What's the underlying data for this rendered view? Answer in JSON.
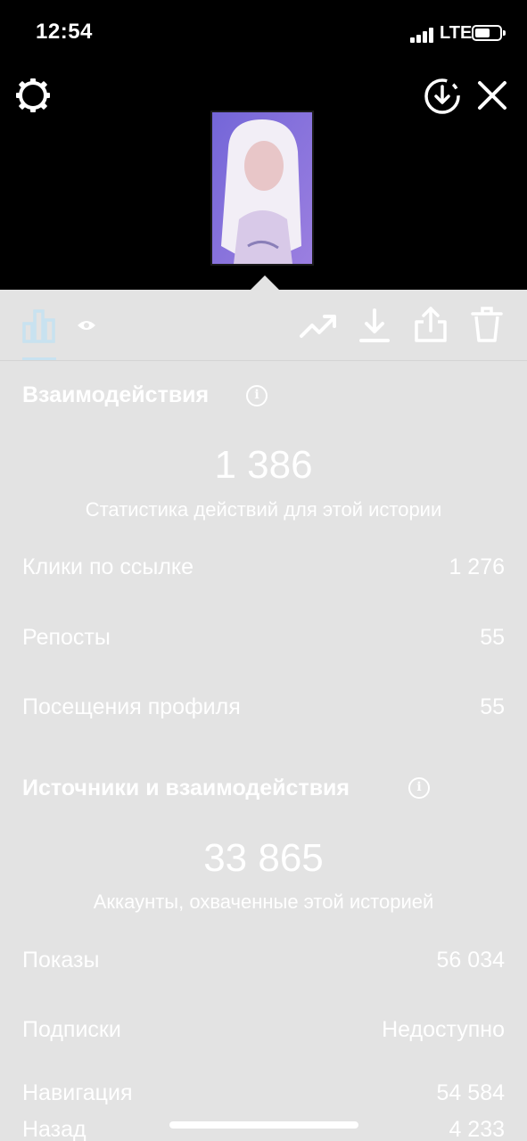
{
  "status_bar": {
    "time": "12:54",
    "network": "LTE"
  },
  "top_bar": {
    "icons": [
      "settings-gear-icon",
      "download-circle-icon",
      "close-icon"
    ]
  },
  "toolbar": {
    "tabs": [
      "insights-bar-chart-icon",
      "viewers-eye-icon"
    ],
    "actions": [
      "promote-trend-icon",
      "download-icon",
      "share-icon",
      "delete-trash-icon"
    ],
    "active_tab_color": "#c8e2f0"
  },
  "interactions": {
    "title": "Взаимодействия",
    "total": "1 386",
    "caption": "Статистика действий для этой истории",
    "rows": [
      {
        "label": "Клики по ссылке",
        "value": "1 276"
      },
      {
        "label": "Репосты",
        "value": "55"
      },
      {
        "label": "Посещения профиля",
        "value": "55"
      }
    ]
  },
  "discovery": {
    "title": "Источники и взаимодействия",
    "total": "33 865",
    "caption": "Аккаунты, охваченные этой историей",
    "rows": [
      {
        "label": "Показы",
        "value": "56 034"
      },
      {
        "label": "Подписки",
        "value": "Недоступно"
      },
      {
        "label": "Навигация",
        "value": "54 584"
      },
      {
        "label": "Назад",
        "value": "4 233"
      }
    ]
  },
  "colors": {
    "background": "#e3e3e3",
    "top_background": "#000000",
    "text": "#ffffff"
  }
}
